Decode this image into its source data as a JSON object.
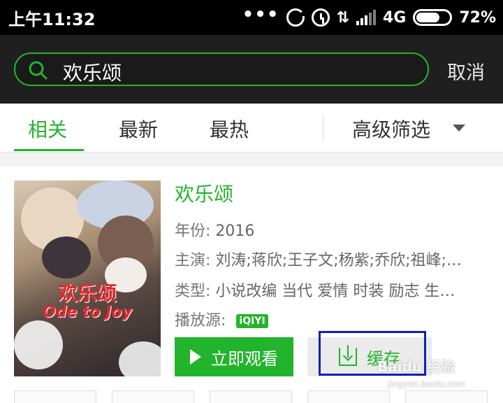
{
  "status_bar": {
    "time": "上午11:32",
    "network": "4G",
    "battery": "72%",
    "battery_level": 0.72,
    "icons": [
      "more-dots-icon",
      "sync-icon",
      "alarm-icon",
      "data-arrows-icon",
      "signal-icon",
      "battery-icon"
    ]
  },
  "search": {
    "query": "欢乐颂",
    "cancel_label": "取消",
    "accent_color": "#22b42c"
  },
  "tabs": {
    "items": [
      {
        "label": "相关",
        "active": true
      },
      {
        "label": "最新",
        "active": false
      },
      {
        "label": "最热",
        "active": false
      }
    ],
    "filter_label": "高级筛选"
  },
  "result": {
    "title": "欢乐颂",
    "year_label": "年份:",
    "year_value": "2016",
    "cast_label": "主演:",
    "cast_value": "刘涛;蒋欣;王子文;杨紫;乔欣;祖峰;…",
    "genre_label": "类型:",
    "genre_value": "小说改编 当代 爱情 时装 励志 生…",
    "source_label": "播放源:",
    "source_name": "iQIYI",
    "poster_title": "欢乐颂",
    "poster_subtitle": "Ode to Joy",
    "play_label": "立即观看",
    "cache_label": "缓存"
  },
  "watermark": {
    "text": "Baidu 经验",
    "url": "jingyan.baidu.com"
  }
}
